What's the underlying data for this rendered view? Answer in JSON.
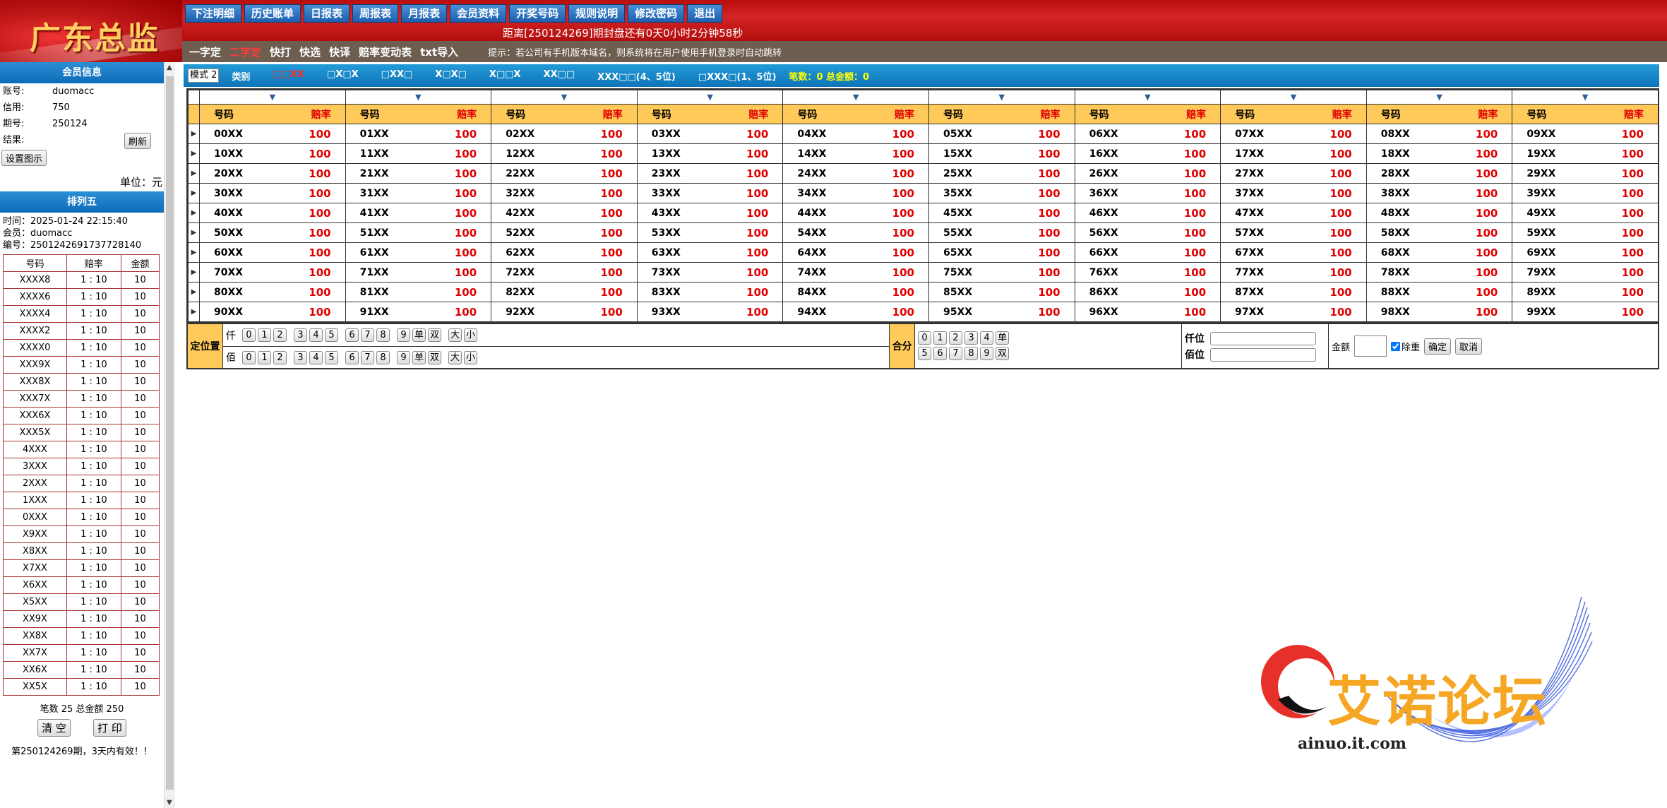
{
  "brand": {
    "title": "广东总监"
  },
  "nav": [
    "下注明细",
    "历史账单",
    "日报表",
    "周报表",
    "月报表",
    "会员资料",
    "开奖号码",
    "规则说明",
    "修改密码",
    "退出"
  ],
  "countdown": "距离[250124269]期封盘还有0天0小时2分钟58秒",
  "subnav": {
    "items": [
      "一字定",
      "二字定",
      "快打",
      "快选",
      "快译",
      "赔率变动表",
      "txt导入"
    ],
    "active": "二字定",
    "tip": "提示：若公司有手机版本域名，则系统将在用户使用手机登录时自动跳转"
  },
  "member": {
    "header": "会员信息",
    "account_label": "账号:",
    "account": "duomacc",
    "credit_label": "信用:",
    "credit": "750",
    "period_label": "期号:",
    "period": "250124",
    "result_label": "结果:",
    "refresh_label": "刷新",
    "set_demo_label": "设置图示",
    "unit": "单位：元"
  },
  "ticket": {
    "header": "排列五",
    "time": "时间：2025-01-24 22:15:40",
    "member": "会员：duomacc",
    "number": "编号：250124269173772814​0",
    "columns": [
      "号码",
      "赔率",
      "金额"
    ],
    "rows": [
      [
        "XXXX8",
        "1 : 10",
        "10"
      ],
      [
        "XXXX6",
        "1 : 10",
        "10"
      ],
      [
        "XXXX4",
        "1 : 10",
        "10"
      ],
      [
        "XXXX2",
        "1 : 10",
        "10"
      ],
      [
        "XXXX0",
        "1 : 10",
        "10"
      ],
      [
        "XXX9X",
        "1 : 10",
        "10"
      ],
      [
        "XXX8X",
        "1 : 10",
        "10"
      ],
      [
        "XXX7X",
        "1 : 10",
        "10"
      ],
      [
        "XXX6X",
        "1 : 10",
        "10"
      ],
      [
        "XXX5X",
        "1 : 10",
        "10"
      ],
      [
        "4XXX",
        "1 : 10",
        "10"
      ],
      [
        "3XXX",
        "1 : 10",
        "10"
      ],
      [
        "2XXX",
        "1 : 10",
        "10"
      ],
      [
        "1XXX",
        "1 : 10",
        "10"
      ],
      [
        "0XXX",
        "1 : 10",
        "10"
      ],
      [
        "X9XX",
        "1 : 10",
        "10"
      ],
      [
        "X8XX",
        "1 : 10",
        "10"
      ],
      [
        "X7XX",
        "1 : 10",
        "10"
      ],
      [
        "X6XX",
        "1 : 10",
        "10"
      ],
      [
        "X5XX",
        "1 : 10",
        "10"
      ],
      [
        "XX9X",
        "1 : 10",
        "10"
      ],
      [
        "XX8X",
        "1 : 10",
        "10"
      ],
      [
        "XX7X",
        "1 : 10",
        "10"
      ],
      [
        "XX6X",
        "1 : 10",
        "10"
      ],
      [
        "XX5X",
        "1 : 10",
        "10"
      ]
    ],
    "summary": "笔数 25 总金额 250",
    "clear_label": "清 空",
    "print_label": "打 印",
    "validity": "第250124269期，3天内有效！！"
  },
  "modebar": {
    "mode": "模式 2",
    "items": [
      {
        "t": "类别",
        "red": false
      },
      {
        "t": "□□XX",
        "red": true
      },
      {
        "t": "□X□X",
        "red": false
      },
      {
        "t": "□XX□",
        "red": false
      },
      {
        "t": "X□X□",
        "red": false
      },
      {
        "t": "X□□X",
        "red": false
      },
      {
        "t": "XX□□",
        "red": false
      },
      {
        "t": "XXX□□(4、5位)",
        "red": false
      },
      {
        "t": "□XXX□(1、5位)",
        "red": false
      }
    ],
    "stats": "笔数：0 总金额：0"
  },
  "grid": {
    "code_header": "号码",
    "odds_header": "赔率",
    "odds": "100",
    "suffix": "XX"
  },
  "filter": {
    "position_label": "定位置",
    "thousands_label": "仟",
    "hundreds_label": "佰",
    "digits": [
      "0",
      "1",
      "2",
      "3",
      "4",
      "5",
      "6",
      "7",
      "8",
      "9"
    ],
    "pos_extra": [
      "单",
      "双",
      "大",
      "小"
    ],
    "sum_label": "合分",
    "sum_row1": [
      "0",
      "1",
      "2",
      "3",
      "4",
      "单"
    ],
    "sum_row2": [
      "5",
      "6",
      "7",
      "8",
      "9",
      "双"
    ],
    "qian_label": "仟位",
    "bai_label": "佰位",
    "amount_label": "金额",
    "dedupe_label": "除重",
    "confirm_label": "确定",
    "cancel_label": "取消"
  },
  "watermark": {
    "text": "艾诺论坛",
    "url": "ainuo.it.com"
  },
  "colors": {
    "header_red": "#c01818",
    "nav_blue": "#1c5fae",
    "grid_header": "#ffca5a",
    "odds_red": "#e00000"
  }
}
